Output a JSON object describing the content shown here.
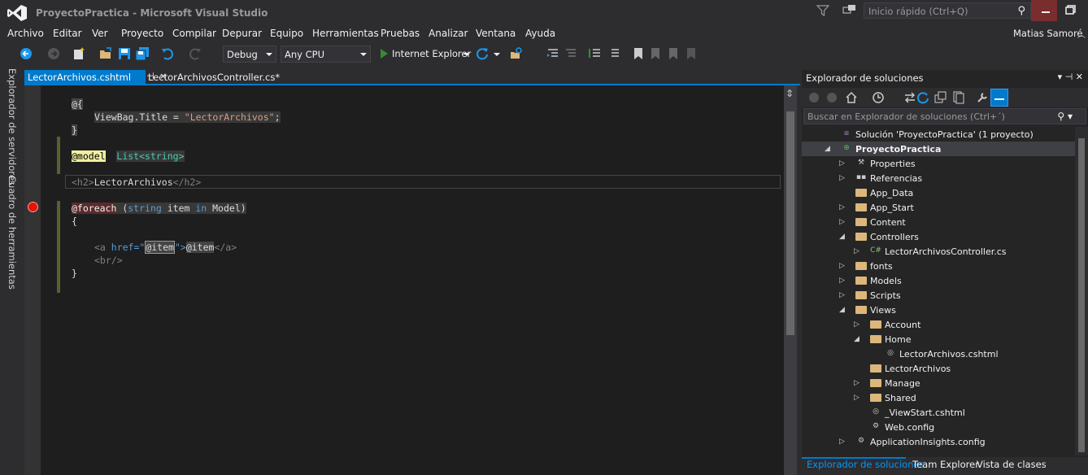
{
  "window": {
    "title": "ProyectoPractica - Microsoft Visual Studio"
  },
  "quick_launch": {
    "placeholder": "Inicio rápido (Ctrl+Q)"
  },
  "menu": [
    "Archivo",
    "Editar",
    "Ver",
    "Proyecto",
    "Compilar",
    "Depurar",
    "Equipo",
    "Herramientas",
    "Pruebas",
    "Analizar",
    "Ventana",
    "Ayuda"
  ],
  "user": {
    "name": "Matias Samoré"
  },
  "toolbar": {
    "configuration": "Debug",
    "platform": "Any CPU",
    "run_target": "Internet Explorer"
  },
  "side_tabs": [
    "Explorador de servidores",
    "Cuadro de herramientas"
  ],
  "doc_tabs": {
    "active": "LectorArchivos.cshtml",
    "pin": "⊣",
    "close": "×",
    "inactive": "LectorArchivosController.cs*"
  },
  "code": {
    "l1": "@{",
    "l2": "ViewBag.Title = ",
    "l2_str": "\"LectorArchivos\"",
    "l2_end": ";",
    "l3": "}",
    "l4_at": "@model",
    "l4_type": "List<string>",
    "l5_open": "<h2>",
    "l5_text": "LectorArchivos",
    "l5_close": "</h2>",
    "l6_at": "@foreach",
    "l6_rest1": " (",
    "l6_kw1": "string",
    "l6_rest2": " item ",
    "l6_kw2": "in",
    "l6_rest3": " Model)",
    "l7": "{",
    "l8_a_open": "<a ",
    "l8_attr": "href=\"",
    "l8_at1": "@item",
    "l8_q": "\">",
    "l8_at2": "@item",
    "l8_a_close": "</a>",
    "l9": "<br/>",
    "l10": "}"
  },
  "solution_explorer": {
    "title": "Explorador de soluciones",
    "search_placeholder": "Buscar en Explorador de soluciones (Ctrl+´)",
    "tree": [
      {
        "label": "Solución 'ProyectoPractica'  (1 proyecto)",
        "depth": 0,
        "expander": "",
        "icon": "solution-icon"
      },
      {
        "label": "ProyectoPractica",
        "depth": 0,
        "expander": "◢",
        "icon": "web-project-icon",
        "selected": true,
        "bold": true
      },
      {
        "label": "Properties",
        "depth": 1,
        "expander": "▷",
        "icon": "wrench-icon"
      },
      {
        "label": "Referencias",
        "depth": 1,
        "expander": "▷",
        "icon": "references-icon"
      },
      {
        "label": "App_Data",
        "depth": 1,
        "expander": "",
        "icon": "folder-icon"
      },
      {
        "label": "App_Start",
        "depth": 1,
        "expander": "▷",
        "icon": "folder-icon"
      },
      {
        "label": "Content",
        "depth": 1,
        "expander": "▷",
        "icon": "folder-icon"
      },
      {
        "label": "Controllers",
        "depth": 1,
        "expander": "◢",
        "icon": "folder-icon"
      },
      {
        "label": "LectorArchivosController.cs",
        "depth": 2,
        "expander": "▷",
        "icon": "csharp-file-icon"
      },
      {
        "label": "fonts",
        "depth": 1,
        "expander": "▷",
        "icon": "folder-icon"
      },
      {
        "label": "Models",
        "depth": 1,
        "expander": "▷",
        "icon": "folder-icon"
      },
      {
        "label": "Scripts",
        "depth": 1,
        "expander": "▷",
        "icon": "folder-icon"
      },
      {
        "label": "Views",
        "depth": 1,
        "expander": "◢",
        "icon": "folder-icon"
      },
      {
        "label": "Account",
        "depth": 2,
        "expander": "▷",
        "icon": "folder-icon"
      },
      {
        "label": "Home",
        "depth": 2,
        "expander": "◢",
        "icon": "folder-icon"
      },
      {
        "label": "LectorArchivos.cshtml",
        "depth": 3,
        "expander": "",
        "icon": "razor-file-icon"
      },
      {
        "label": "LectorArchivos",
        "depth": 2,
        "expander": "",
        "icon": "folder-icon"
      },
      {
        "label": "Manage",
        "depth": 2,
        "expander": "▷",
        "icon": "folder-icon"
      },
      {
        "label": "Shared",
        "depth": 2,
        "expander": "▷",
        "icon": "folder-icon"
      },
      {
        "label": "_ViewStart.cshtml",
        "depth": 2,
        "expander": "",
        "icon": "razor-file-icon"
      },
      {
        "label": "Web.config",
        "depth": 2,
        "expander": "",
        "icon": "config-file-icon"
      },
      {
        "label": "ApplicationInsights.config",
        "depth": 1,
        "expander": "▷",
        "icon": "config-file-icon"
      }
    ],
    "bottom_tabs": [
      "Explorador de soluciones",
      "Team Explorer",
      "Vista de clases"
    ]
  },
  "colors": {
    "accent": "#007acc",
    "background": "#2d2d30",
    "editor": "#1e1e1e",
    "folder": "#dcb67a",
    "breakpoint": "#e51400"
  }
}
